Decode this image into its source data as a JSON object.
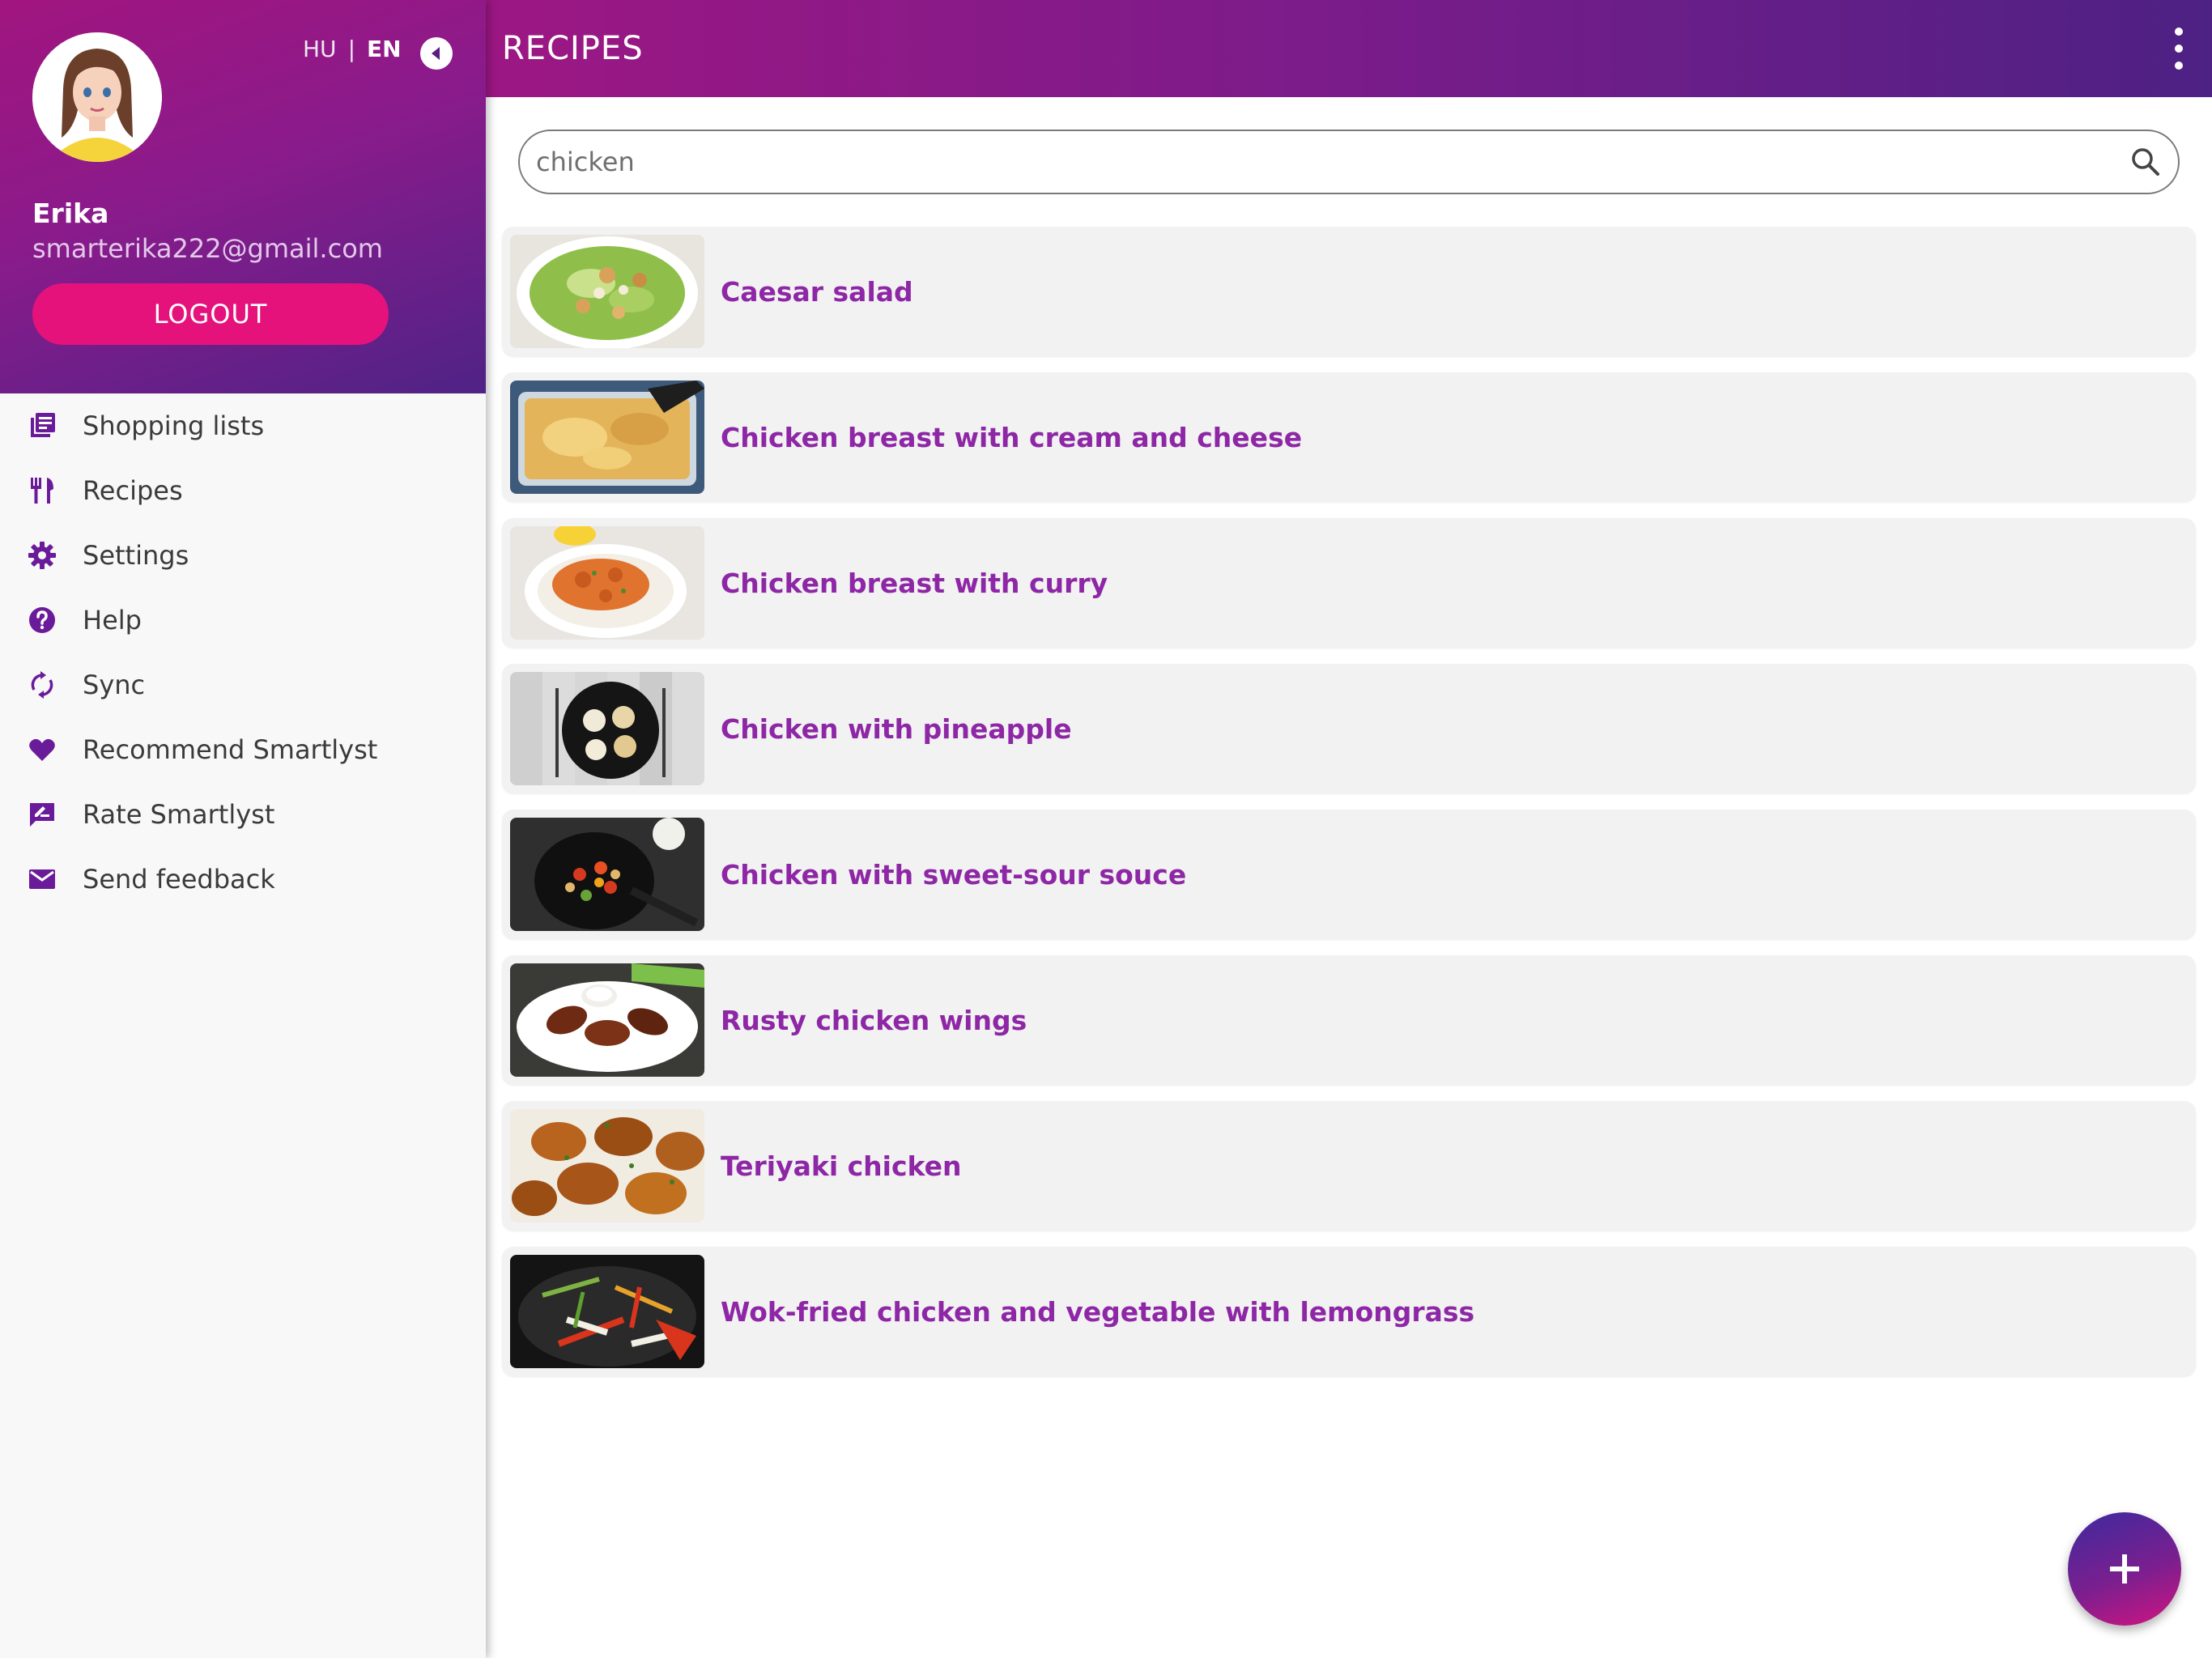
{
  "app": {
    "title": "RECIPES",
    "accent_color": "#8e27a6",
    "logout_color": "#e6127c"
  },
  "header_actions": {
    "menu_icon": "more-vert-icon"
  },
  "drawer": {
    "user": {
      "name": "Erika",
      "email": "smarterika222@gmail.com",
      "avatar": "avatar-woman"
    },
    "language": {
      "hu": "HU",
      "separator": "|",
      "en": "EN",
      "active": "EN"
    },
    "collapse_icon": "chevron-left-icon",
    "logout_label": "LOGOUT",
    "nav": [
      {
        "label": "Shopping lists",
        "icon": "list-icon"
      },
      {
        "label": "Recipes",
        "icon": "utensils-icon"
      },
      {
        "label": "Settings",
        "icon": "gear-icon"
      },
      {
        "label": "Help",
        "icon": "help-icon"
      },
      {
        "label": "Sync",
        "icon": "sync-icon"
      },
      {
        "label": "Recommend Smartlyst",
        "icon": "heart-icon"
      },
      {
        "label": "Rate Smartlyst",
        "icon": "rate-icon"
      },
      {
        "label": "Send feedback",
        "icon": "mail-icon"
      }
    ]
  },
  "search": {
    "value": "chicken",
    "icon": "search-icon"
  },
  "recipes": [
    {
      "name": "Caesar salad"
    },
    {
      "name": "Chicken breast with cream and cheese"
    },
    {
      "name": "Chicken breast with curry"
    },
    {
      "name": "Chicken with pineapple"
    },
    {
      "name": "Chicken with sweet-sour souce"
    },
    {
      "name": "Rusty chicken wings"
    },
    {
      "name": "Teriyaki chicken"
    },
    {
      "name": "Wok-fried chicken and vegetable with lemongrass"
    }
  ],
  "fab": {
    "icon": "plus-icon"
  }
}
